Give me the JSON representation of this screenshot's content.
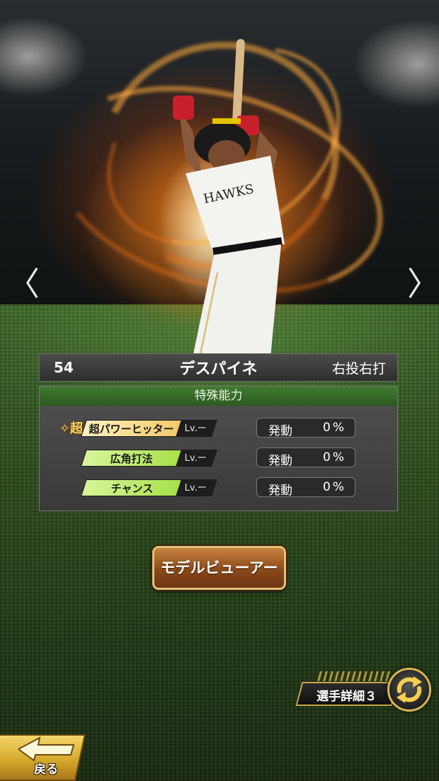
{
  "nav": {
    "prev_glyph": "〈",
    "next_glyph": "〉"
  },
  "player": {
    "number": "54",
    "name": "デスパイネ",
    "handedness": "右投右打"
  },
  "abilities": {
    "header": "特殊能力",
    "items": [
      {
        "super_mark": "✧超",
        "name": "超パワーヒッター",
        "level": "Lv.ー",
        "trigger_label": "発動",
        "trigger_value": "0%",
        "color": "#f2c96a"
      },
      {
        "name": "広角打法",
        "level": "Lv.ー",
        "trigger_label": "発動",
        "trigger_value": "0%",
        "color": "#a7e04a"
      },
      {
        "name": "チャンス",
        "level": "Lv.ー",
        "trigger_label": "発動",
        "trigger_value": "0%",
        "color": "#a7e04a"
      }
    ]
  },
  "buttons": {
    "model_viewer": "モデルビューアー",
    "player_detail": "選手詳細３",
    "back": "戻る"
  },
  "colors": {
    "accent_gold": "#c9a64a",
    "panel_green": "#2c5a20",
    "button_brown": "#8a4a1a"
  }
}
